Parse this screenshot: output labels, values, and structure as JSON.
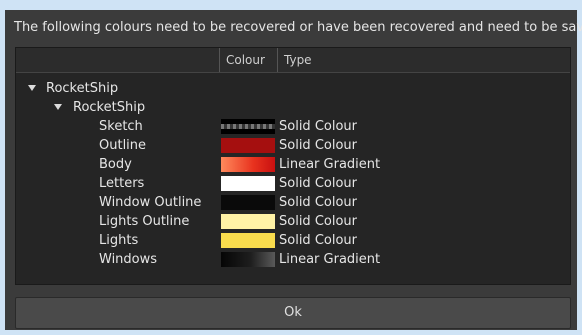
{
  "message": "The following colours need to be recovered or have been recovered and need to be saved.",
  "columns": {
    "colour": "Colour",
    "type": "Type"
  },
  "tree": {
    "root": "RocketShip",
    "child": "RocketShip",
    "items": [
      {
        "name": "Sketch",
        "type": "Solid Colour",
        "swatch": "sketch"
      },
      {
        "name": "Outline",
        "type": "Solid Colour",
        "swatch": "#a50f0f"
      },
      {
        "name": "Body",
        "type": "Linear Gradient",
        "swatch": "body-gradient"
      },
      {
        "name": "Letters",
        "type": "Solid Colour",
        "swatch": "#ffffff"
      },
      {
        "name": "Window Outline",
        "type": "Solid Colour",
        "swatch": "#0a0a0a"
      },
      {
        "name": "Lights Outline",
        "type": "Solid Colour",
        "swatch": "#fff2a6"
      },
      {
        "name": "Lights",
        "type": "Solid Colour",
        "swatch": "#f9dc4d"
      },
      {
        "name": "Windows",
        "type": "Linear Gradient",
        "swatch": "windows-gradient"
      }
    ]
  },
  "ok_label": "Ok"
}
